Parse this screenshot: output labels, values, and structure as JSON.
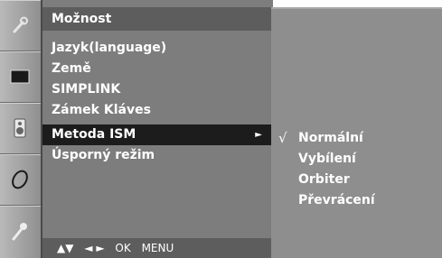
{
  "rail": {
    "icons": [
      "tool-icon",
      "screen-icon",
      "speaker-icon",
      "clock-icon",
      "option-icon"
    ]
  },
  "menu": {
    "title": "Možnost",
    "items": [
      {
        "label": "Jazyk(language)"
      },
      {
        "label": "Země"
      },
      {
        "label": "SIMPLINK"
      },
      {
        "label": "Zámek Kláves"
      },
      {
        "label": "Metoda ISM",
        "selected": true,
        "arrow": "►"
      },
      {
        "label": "Úsporný režim"
      }
    ],
    "footer": {
      "updown": "▲▼",
      "leftright": "◄ ►",
      "ok": "OK",
      "menu": "MENU"
    }
  },
  "submenu": {
    "checkmark": "√",
    "items": [
      {
        "label": "Normální",
        "checked": true
      },
      {
        "label": "Vybílení"
      },
      {
        "label": "Orbiter"
      },
      {
        "label": "Převrácení"
      }
    ]
  },
  "colors": {
    "rail": "#a5a5a5",
    "menu_bg": "#7d7d7d",
    "title_bg": "#5d5d5d",
    "selected_bg": "#1c1c1c",
    "submenu_bg": "#8e8e8e",
    "text": "#ffffff"
  }
}
